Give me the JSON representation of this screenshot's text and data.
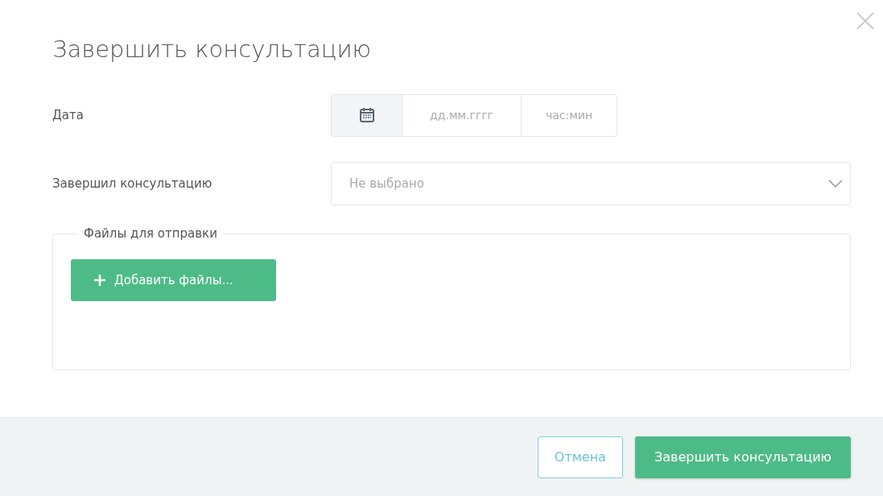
{
  "dialog": {
    "title": "Завершить консультацию"
  },
  "date_field": {
    "label": "Дата",
    "date_placeholder": "дд.мм.гггг",
    "time_placeholder": "час:мин"
  },
  "finished_by": {
    "label": "Завершил консультацию",
    "placeholder": "Не выбрано"
  },
  "files": {
    "legend": "Файлы для отправки",
    "add_button": "Добавить файлы..."
  },
  "footer_buttons": [
    {
      "label": "Отмена",
      "kind": "outline"
    },
    {
      "label": "Завершить консультацию",
      "kind": "primary"
    }
  ]
}
